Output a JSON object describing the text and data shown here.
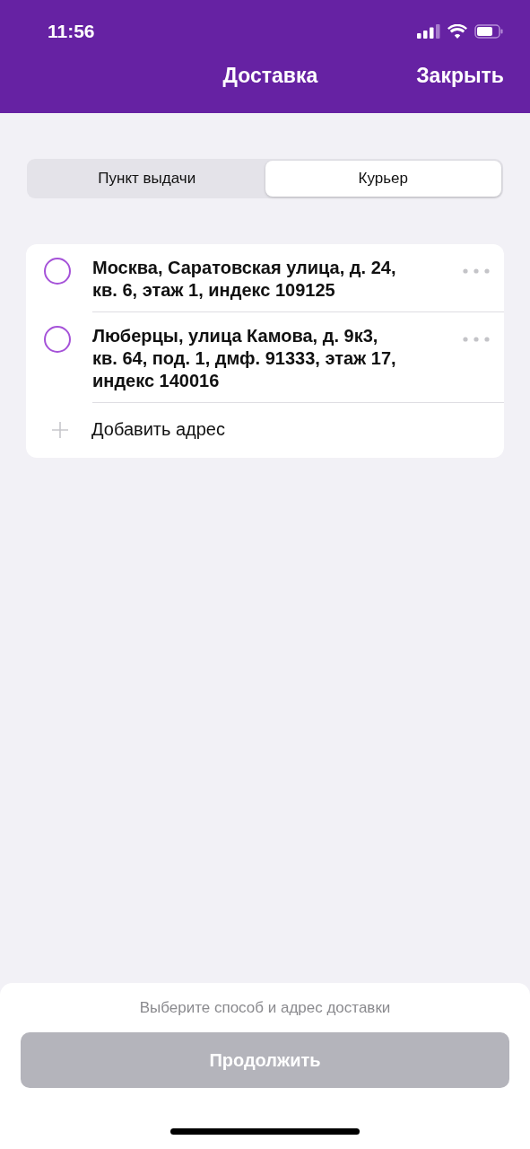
{
  "status_bar": {
    "time": "11:56"
  },
  "nav": {
    "title": "Доставка",
    "close": "Закрыть"
  },
  "tabs": [
    {
      "label": "Пункт выдачи",
      "selected": false
    },
    {
      "label": "Курьер",
      "selected": true
    }
  ],
  "addresses": [
    {
      "lines": [
        "Москва, Саратовская улица, д. 24,",
        "кв. 6, этаж 1, индекс 109125"
      ],
      "selected": false
    },
    {
      "lines": [
        "Люберцы, улица Камова, д. 9к3,",
        "кв. 64, под. 1, дмф. 91333, этаж 17,",
        "индекс 140016"
      ],
      "selected": false
    }
  ],
  "add_address": "Добавить адрес",
  "footer": {
    "hint": "Выберите способ и адрес доставки",
    "button": {
      "label": "Продолжить",
      "disabled": true
    }
  }
}
